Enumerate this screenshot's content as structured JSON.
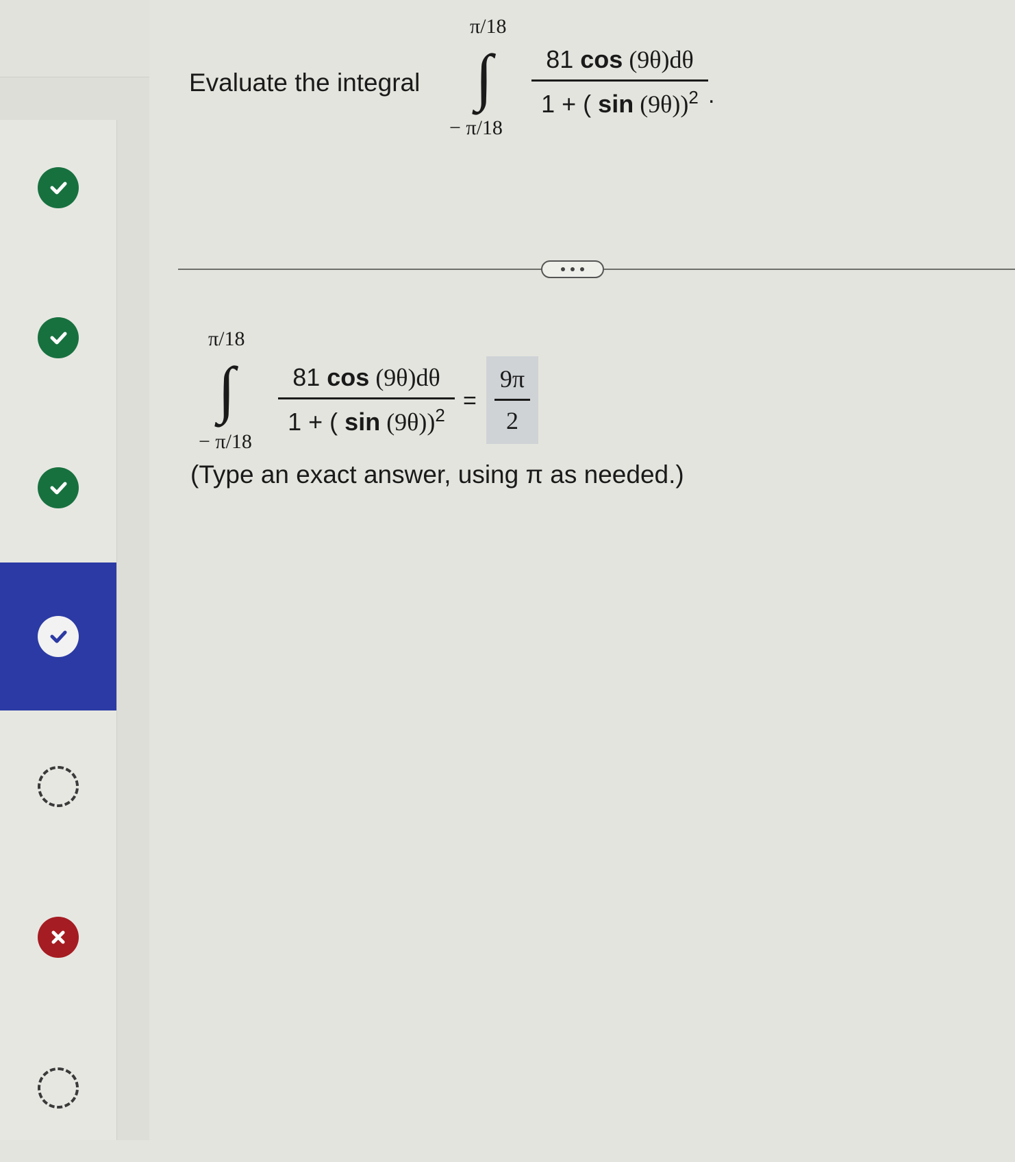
{
  "sidebar": {
    "items": [
      {
        "status": "correct",
        "icon": "check-icon"
      },
      {
        "status": "correct",
        "icon": "check-icon"
      },
      {
        "status": "correct",
        "icon": "check-icon"
      },
      {
        "status": "correct-active",
        "icon": "check-icon"
      },
      {
        "status": "not-attempted",
        "icon": "dashed-circle-icon"
      },
      {
        "status": "incorrect",
        "icon": "x-icon"
      },
      {
        "status": "not-attempted",
        "icon": "dashed-circle-icon"
      }
    ]
  },
  "question": {
    "prompt": "Evaluate the integral",
    "upper_limit": "π/18",
    "lower_limit": "− π/18",
    "integrand_numerator_coef": "81",
    "integrand_numerator_func": "cos",
    "integrand_numerator_rest": " (9θ)dθ",
    "integrand_denominator_start": "1 + ( ",
    "integrand_denominator_func": "sin",
    "integrand_denominator_rest": " (9θ))",
    "exponent": "2",
    "period": "."
  },
  "more_button": {
    "label": "more-options"
  },
  "answer": {
    "equals": "=",
    "numerator": "9π",
    "denominator": "2",
    "instruction": "(Type an exact answer, using π as needed.)"
  }
}
